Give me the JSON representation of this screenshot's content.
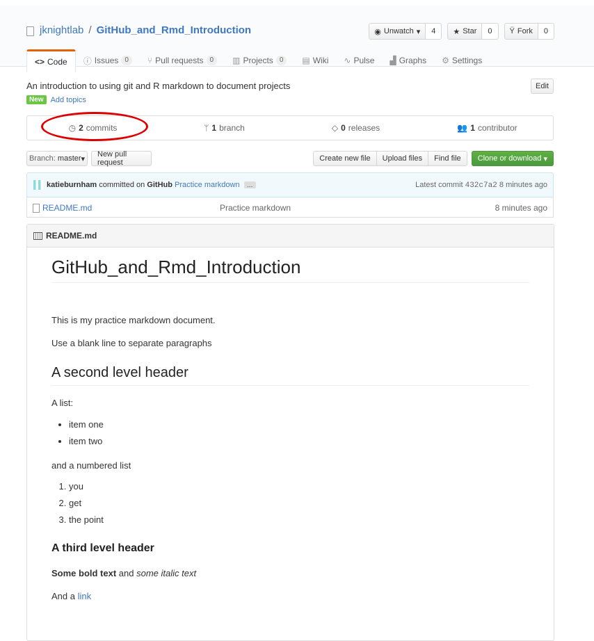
{
  "repo": {
    "owner": "jknightlab",
    "name": "GitHub_and_Rmd_Introduction"
  },
  "actions": {
    "watch_label": "Unwatch",
    "watch_count": "4",
    "star_label": "Star",
    "star_count": "0",
    "fork_label": "Fork",
    "fork_count": "0"
  },
  "tabs": [
    {
      "label": "Code",
      "count": ""
    },
    {
      "label": "Issues",
      "count": "0"
    },
    {
      "label": "Pull requests",
      "count": "0"
    },
    {
      "label": "Projects",
      "count": "0"
    },
    {
      "label": "Wiki",
      "count": ""
    },
    {
      "label": "Pulse",
      "count": ""
    },
    {
      "label": "Graphs",
      "count": ""
    },
    {
      "label": "Settings",
      "count": ""
    }
  ],
  "description": "An introduction to using git and R markdown to document projects",
  "edit_label": "Edit",
  "new_badge": "New",
  "add_topics": "Add topics",
  "summary": {
    "commits_num": "2",
    "commits_label": "commits",
    "branch_num": "1",
    "branch_label": "branch",
    "releases_num": "0",
    "releases_label": "releases",
    "contributor_num": "1",
    "contributor_label": "contributor"
  },
  "file_nav": {
    "branch_prefix": "Branch:",
    "branch_name": "master",
    "new_pr": "New pull request",
    "create_file": "Create new file",
    "upload_files": "Upload files",
    "find_file": "Find file",
    "clone": "Clone or download"
  },
  "commit": {
    "author": "katieburnham",
    "committed_on": "committed on",
    "platform": "GitHub",
    "message": "Practice markdown",
    "ellipsis": "…",
    "latest_label": "Latest commit",
    "sha": "432c7a2",
    "age": "8 minutes ago"
  },
  "files": [
    {
      "name": "README.md",
      "message": "Practice markdown",
      "age": "8 minutes ago"
    }
  ],
  "readme": {
    "header": "README.md",
    "h1": "GitHub_and_Rmd_Introduction",
    "p1": "This is my practice markdown document.",
    "p2": "Use a blank line to separate paragraphs",
    "h2": "A second level header",
    "list_intro": "A list:",
    "ul": [
      "item one",
      "item two"
    ],
    "numbered_intro": "and a numbered list",
    "ol": [
      "you",
      "get",
      "the point"
    ],
    "h3": "A third level header",
    "bold": "Some bold text",
    "and": " and ",
    "italic": "some italic text",
    "and_a": "And a ",
    "link": "link"
  },
  "icons": {
    "watch": "eye-icon",
    "star": "star-icon",
    "fork": "fork-icon"
  },
  "colors": {
    "accent": "#4078c0",
    "tab_active": "#e36209",
    "green": "#6cc644",
    "annotation": "#dd0000"
  }
}
